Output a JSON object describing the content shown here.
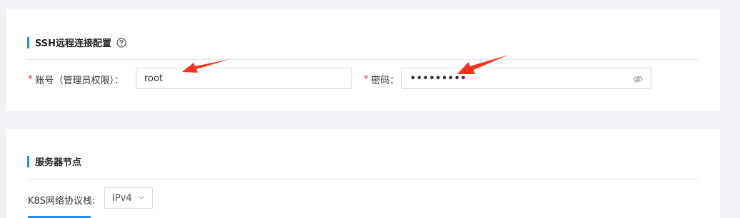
{
  "ssh_section": {
    "title": "SSH远程连接配置",
    "account_label": "账号（管理员权限）：",
    "account_value": "root",
    "password_label": "密码：",
    "password_value": "•••••••••"
  },
  "nodes_section": {
    "title": "服务器节点",
    "network_stack_label": "K8S网络协议栈:",
    "network_stack_value": "IPv4"
  },
  "required_mark": "*",
  "colors": {
    "accent": "#1890ff",
    "required": "#f5222d",
    "annotation_arrow": "#f5321c"
  },
  "icons": [
    "question-circle-icon",
    "eye-invisible-icon",
    "chevron-down-icon"
  ]
}
